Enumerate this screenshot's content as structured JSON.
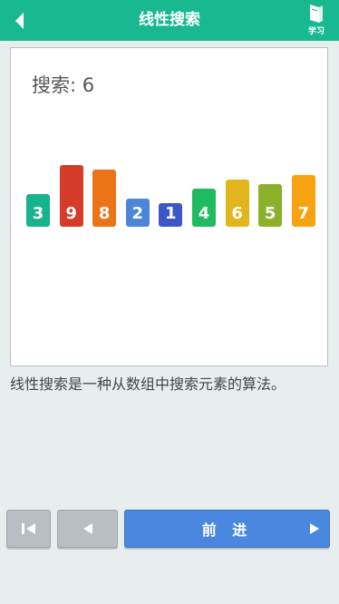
{
  "header": {
    "title": "线性搜索",
    "learn_label": "学习"
  },
  "search": {
    "label": "搜索: 6"
  },
  "chart_data": {
    "type": "bar",
    "categories": [
      "3",
      "9",
      "8",
      "2",
      "1",
      "4",
      "6",
      "5",
      "7"
    ],
    "values": [
      3,
      9,
      8,
      2,
      1,
      4,
      6,
      5,
      7
    ],
    "colors": [
      "#16b38c",
      "#d63a28",
      "#ea7417",
      "#4b86d8",
      "#3e57c8",
      "#1fbb60",
      "#e0b61c",
      "#8bb12a",
      "#f7a311"
    ]
  },
  "description": "线性搜索是一种从数组中搜索元素的算法。",
  "controls": {
    "next_label": "前 进"
  }
}
